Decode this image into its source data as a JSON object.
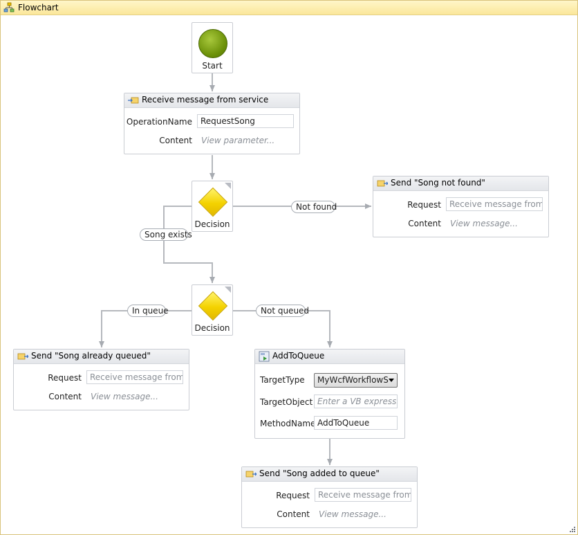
{
  "window": {
    "title": "Flowchart"
  },
  "nodes": {
    "start": {
      "label": "Start"
    },
    "decision1": {
      "label": "Decision"
    },
    "decision2": {
      "label": "Decision"
    }
  },
  "receive": {
    "title": "Receive message from service",
    "operation_label": "OperationName",
    "operation_value": "RequestSong",
    "content_label": "Content",
    "content_hint": "View parameter..."
  },
  "send_not_found": {
    "title": "Send \"Song not found\"",
    "request_label": "Request",
    "request_value": "Receive message from se",
    "content_label": "Content",
    "content_hint": "View message..."
  },
  "send_already_queued": {
    "title": "Send \"Song already queued\"",
    "request_label": "Request",
    "request_value": "Receive message from se",
    "content_label": "Content",
    "content_hint": "View message..."
  },
  "add_to_queue": {
    "title": "AddToQueue",
    "target_type_label": "TargetType",
    "target_type_value": "MyWcfWorkflowS",
    "target_object_label": "TargetObject",
    "target_object_placeholder": "Enter a VB expression",
    "method_name_label": "MethodName",
    "method_name_value": "AddToQueue"
  },
  "send_added": {
    "title": "Send \"Song added to queue\"",
    "request_label": "Request",
    "request_value": "Receive message from se",
    "content_label": "Content",
    "content_hint": "View message..."
  },
  "connectors": {
    "not_found": "Not found",
    "song_exists": "Song exists",
    "in_queue": "In queue",
    "not_queued": "Not queued"
  }
}
